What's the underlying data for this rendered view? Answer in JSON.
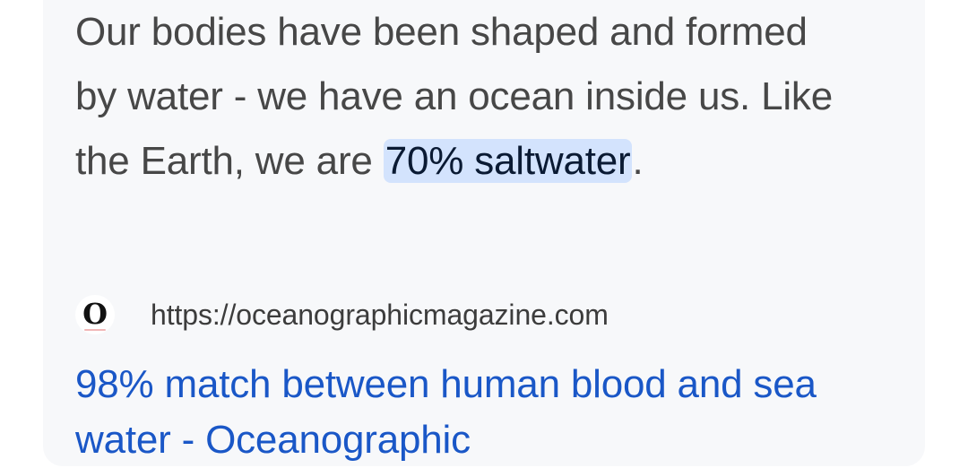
{
  "snippet": {
    "text_before": "Our bodies have been shaped and formed by water - we have an ocean inside us. Like the Earth, we are ",
    "highlight": "70% saltwater",
    "text_after": "."
  },
  "source": {
    "favicon_letter": "O",
    "url": "https://oceanographicmagazine.com"
  },
  "result": {
    "title": "98% match between human blood and sea water - Oceanographic"
  },
  "colors": {
    "card_bg": "#f7f8fa",
    "highlight_bg": "#d3e3fd",
    "link": "#1a57c7",
    "text": "#474747"
  }
}
